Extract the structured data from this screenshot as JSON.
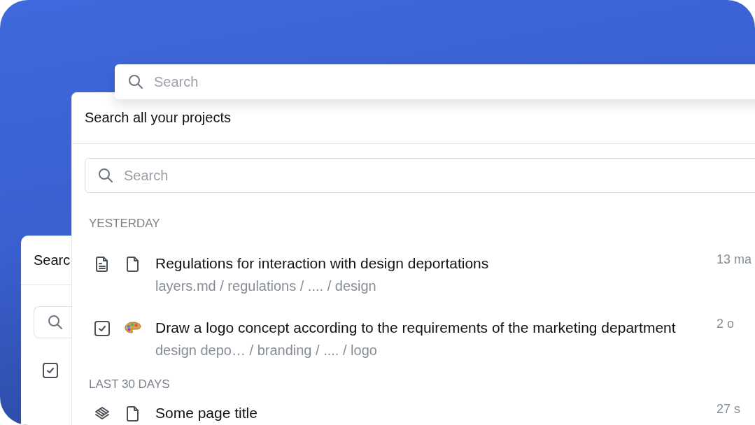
{
  "back_panel": {
    "title": "Searc",
    "items": [
      {
        "kind": "task"
      }
    ]
  },
  "top_search": {
    "placeholder": "Search"
  },
  "panel": {
    "title": "Search all your projects",
    "search": {
      "placeholder": "Search"
    },
    "sections": [
      {
        "label": "YESTERDAY",
        "items": [
          {
            "kind": "document",
            "badge": {
              "kind": "file"
            },
            "title": "Regulations for interaction with design deportations",
            "path": "layers.md / regulations / .... / design",
            "time": "13 ma"
          },
          {
            "kind": "task",
            "badge": {
              "kind": "palette"
            },
            "title": "Draw a logo concept according to the requirements of the marketing department",
            "path": "design depo…  / branding / .... / logo",
            "time": "2 o"
          }
        ]
      },
      {
        "label": "LAST 30 DAYS",
        "items": [
          {
            "kind": "stack",
            "badge": {
              "kind": "file"
            },
            "title": "Some page title",
            "time": "27 s"
          }
        ]
      }
    ]
  }
}
